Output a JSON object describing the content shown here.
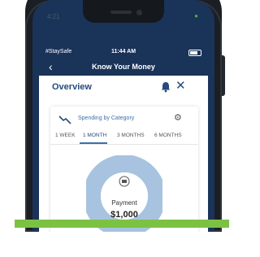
{
  "device": {
    "system_left": "4:21",
    "system_right": "◔"
  },
  "status_bar": {
    "carrier": "#StaySafe",
    "time": "11:44 AM"
  },
  "nav": {
    "back_icon": "chevron-left-icon",
    "title": "Know Your Money"
  },
  "overview": {
    "title": "Overview",
    "bell_icon": "bell-icon",
    "close_icon": "close-icon"
  },
  "spending": {
    "label": "Spending by Category",
    "tabs": [
      {
        "label": "1 WEEK",
        "active": false
      },
      {
        "label": "1 MONTH",
        "active": true
      },
      {
        "label": "3 MONTHS",
        "active": false
      },
      {
        "label": "6 MONTHS",
        "active": false
      }
    ],
    "center_label": "Payment",
    "center_value": "$1,000"
  },
  "colors": {
    "navy": "#1a3359",
    "accent_blue": "#3d6fa8",
    "donut": "#a8c3e0",
    "green": "#7cc242"
  }
}
